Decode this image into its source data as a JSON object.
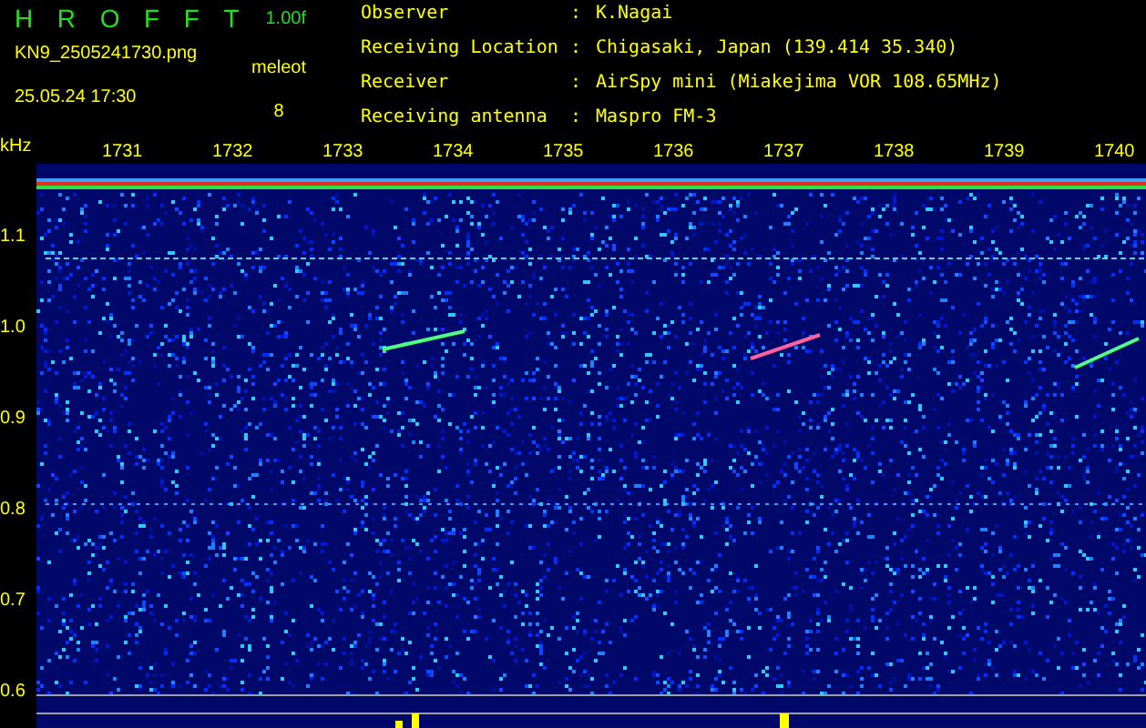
{
  "header": {
    "title": "HROFFT",
    "version": "1.00f",
    "filename": "KN9_2505241730.png",
    "datetime": "25.05.24 17:30",
    "meteor_label": "meleot",
    "meteor_count": "8"
  },
  "info": [
    {
      "label": "Observer",
      "separator": ":",
      "value": "K.Nagai"
    },
    {
      "label": "Receiving Location",
      "separator": ":",
      "value": "Chigasaki, Japan (139.414 35.340)"
    },
    {
      "label": "Receiver",
      "separator": ":",
      "value": "AirSpy mini (Miakejima VOR 108.65MHz)"
    },
    {
      "label": "Receiving antenna",
      "separator": ":",
      "value": "Maspro FM-3"
    }
  ],
  "plot": {
    "unit": "kHz",
    "time_labels": [
      "1731",
      "1732",
      "1733",
      "1734",
      "1735",
      "1736",
      "1737",
      "1738",
      "1739",
      "1740"
    ],
    "freq_labels": [
      "1.1",
      "1.0",
      "0.9",
      "0.8",
      "0.7",
      "0.6"
    ]
  }
}
